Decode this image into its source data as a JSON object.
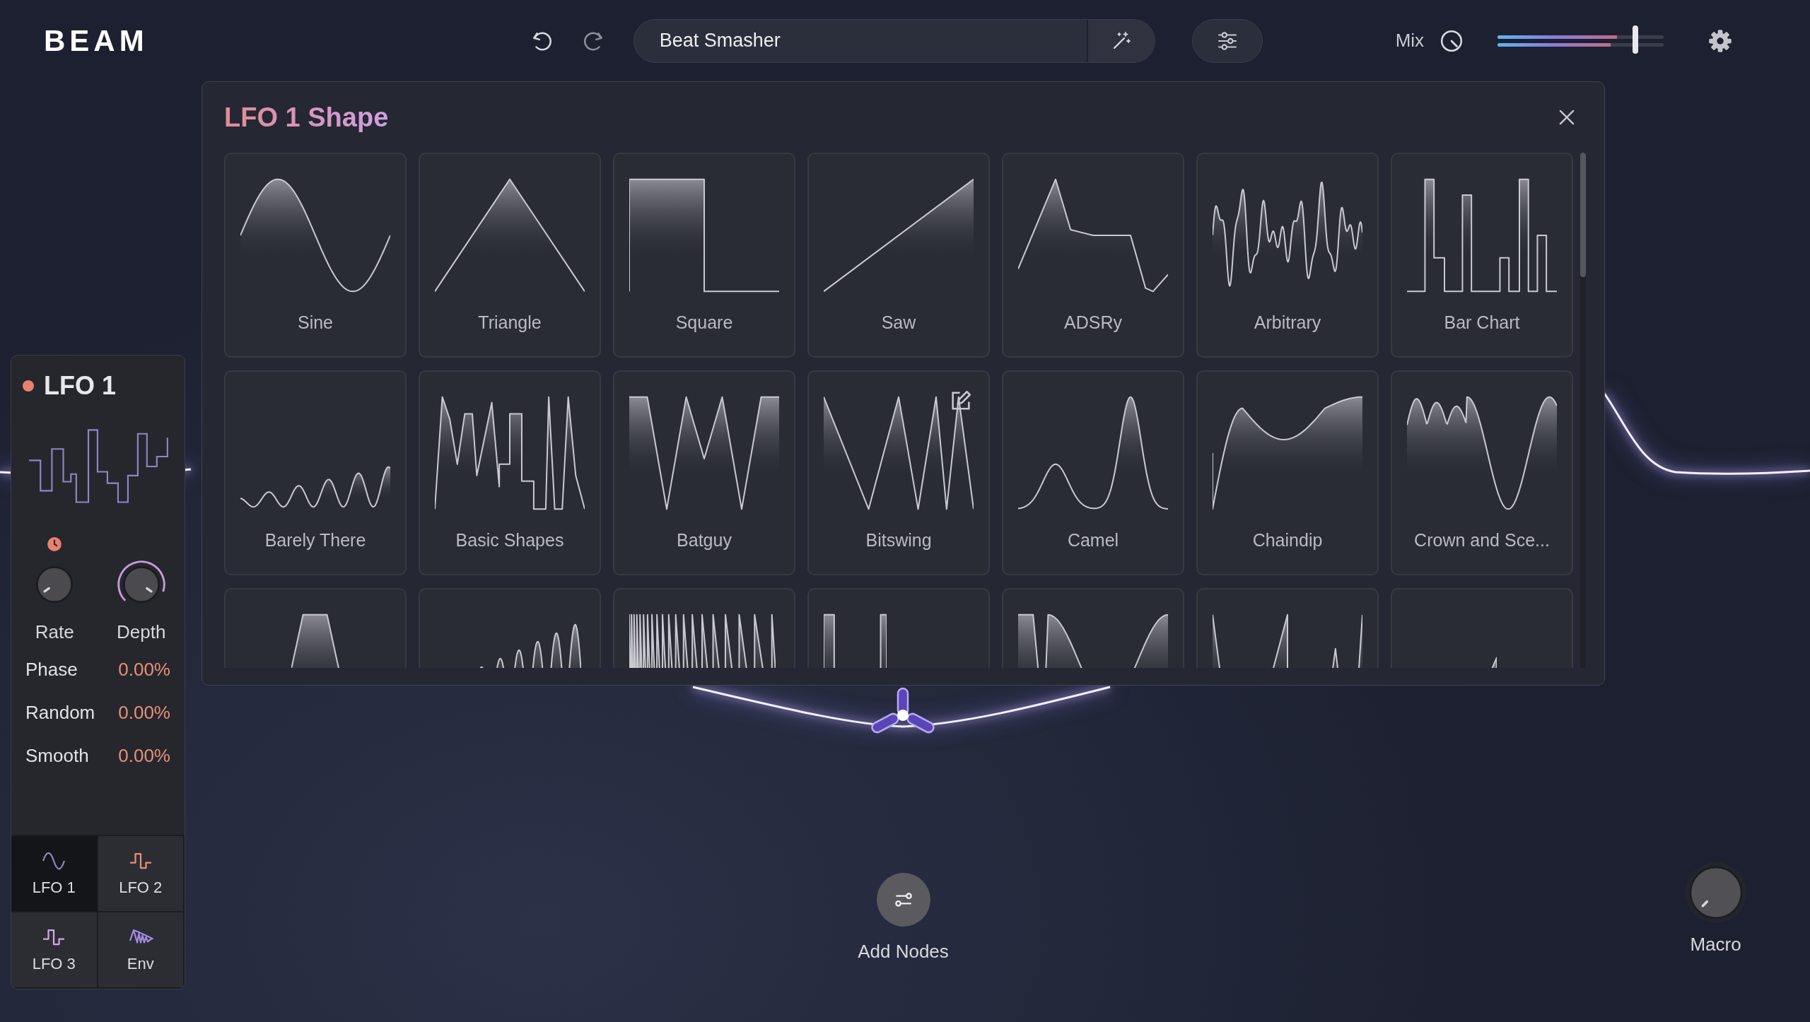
{
  "app": {
    "logo": "BEAM"
  },
  "toolbar": {
    "preset": {
      "value": "Beat Smasher"
    }
  },
  "mix": {
    "label": "Mix",
    "meters": [
      {
        "level": 0.72
      },
      {
        "level": 0.68
      }
    ],
    "fader": {
      "level": 0.83
    }
  },
  "lfo_panel": {
    "title": "LFO 1",
    "status_dot": {
      "color": "#e8816f"
    },
    "knobs": [
      {
        "label": "Rate",
        "kind": "plain",
        "tempo_sync": true
      },
      {
        "label": "Depth",
        "kind": "ring"
      }
    ],
    "params": [
      {
        "label": "Phase",
        "value": "0.00%"
      },
      {
        "label": "Random",
        "value": "0.00%"
      },
      {
        "label": "Smooth",
        "value": "0.00%"
      }
    ],
    "tabs": [
      {
        "label": "LFO 1",
        "kind": "sine",
        "color": "#8f86c8",
        "selected": true
      },
      {
        "label": "LFO 2",
        "kind": "pulse",
        "color": "#e8907a",
        "selected": false
      },
      {
        "label": "LFO 3",
        "kind": "pulse",
        "color": "#d6a6e6",
        "selected": false
      },
      {
        "label": "Env",
        "kind": "envelope",
        "color": "#a48ae0",
        "selected": false
      }
    ]
  },
  "shape_dialog": {
    "title": "LFO 1 Shape",
    "shapes": [
      {
        "name": "Sine",
        "kind": "sine",
        "editable": false
      },
      {
        "name": "Triangle",
        "kind": "triangle",
        "editable": false
      },
      {
        "name": "Square",
        "kind": "square",
        "editable": false
      },
      {
        "name": "Saw",
        "kind": "saw",
        "editable": false
      },
      {
        "name": "ADSRy",
        "kind": "adsr",
        "editable": false
      },
      {
        "name": "Arbitrary",
        "kind": "noise",
        "editable": false
      },
      {
        "name": "Bar Chart",
        "kind": "bars",
        "editable": false
      },
      {
        "name": "Barely There",
        "kind": "swell",
        "editable": false
      },
      {
        "name": "Basic Shapes",
        "kind": "mixed",
        "editable": false
      },
      {
        "name": "Batguy",
        "kind": "batwing",
        "editable": false
      },
      {
        "name": "Bitswing",
        "kind": "zigzag",
        "editable": true
      },
      {
        "name": "Camel",
        "kind": "humps",
        "editable": false
      },
      {
        "name": "Chaindip",
        "kind": "dip",
        "editable": false
      },
      {
        "name": "Crown and Sce...",
        "kind": "crown",
        "editable": false
      },
      {
        "kind": "trapezoid"
      },
      {
        "kind": "spikes"
      },
      {
        "kind": "dense"
      },
      {
        "kind": "steps"
      },
      {
        "kind": "valley"
      },
      {
        "kind": "peaks"
      },
      {
        "kind": "ramp"
      }
    ]
  },
  "add_nodes": {
    "label": "Add Nodes"
  },
  "macro": {
    "label": "Macro"
  }
}
